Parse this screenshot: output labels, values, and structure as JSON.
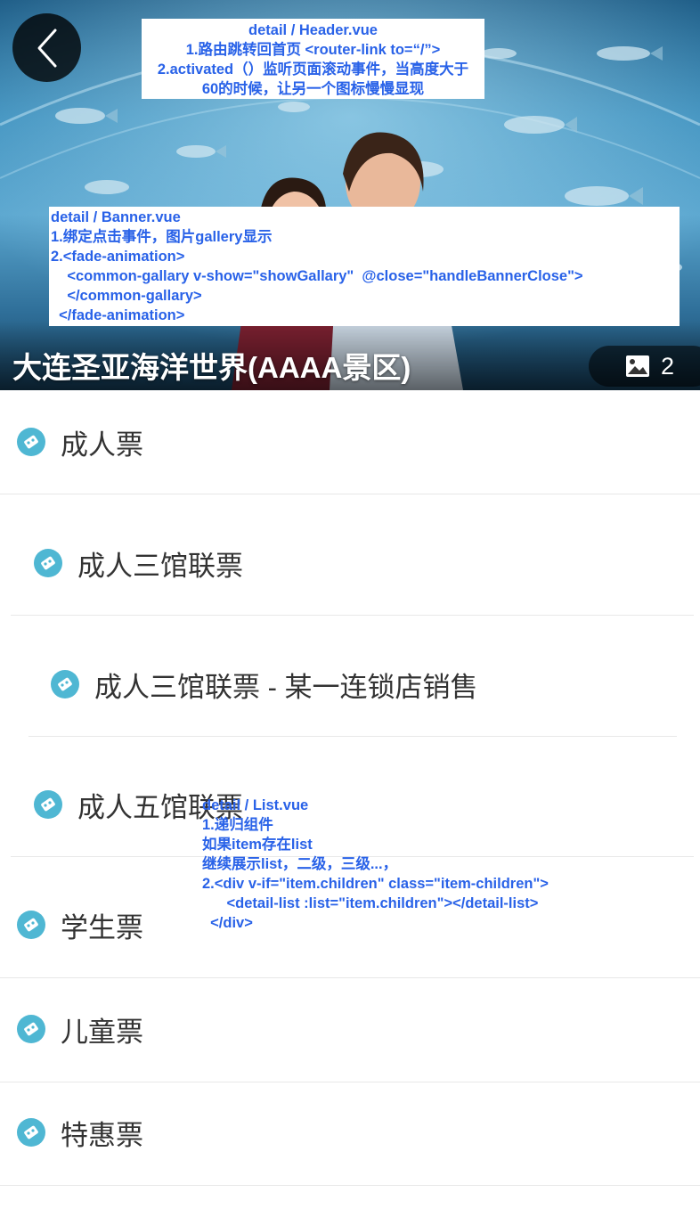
{
  "header": {
    "back_icon": "chevron-left-icon",
    "annotation": {
      "lines": [
        "detail / Header.vue",
        "1.路由跳转回首页 <router-link to=“/”>",
        "2.activated（）监听页面滚动事件，当高度大于",
        "60的时候，让另一个图标慢慢显现"
      ]
    }
  },
  "banner": {
    "title": "大连圣亚海洋世界(AAAA景区)",
    "gallery_icon": "image-icon",
    "gallery_count": "2",
    "annotation": {
      "lines": [
        "detail / Banner.vue",
        "1.绑定点击事件，图片gallery显示",
        "2.<fade-animation>",
        "    <common-gallary v-show=\"showGallary\"  @close=\"handleBannerClose\">",
        "    </common-gallary>",
        "  </fade-animation>"
      ]
    }
  },
  "list": {
    "annotation": {
      "lines": [
        "detail / List.vue",
        "1.递归组件",
        "如果item存在list",
        "继续展示list，二级，三级...，",
        "2.<div v-if=\"item.children\" class=\"item-children\">",
        "      <detail-list :list=\"item.children\"></detail-list>",
        "  </div>"
      ]
    },
    "items": [
      {
        "label": "成人票",
        "icon": "ticket-icon",
        "level": 1
      },
      {
        "label": "成人三馆联票",
        "icon": "ticket-icon",
        "level": 2
      },
      {
        "label": "成人三馆联票 - 某一连锁店销售",
        "icon": "ticket-icon",
        "level": 3
      },
      {
        "label": "成人五馆联票",
        "icon": "ticket-icon",
        "level": 2
      },
      {
        "label": "学生票",
        "icon": "ticket-icon",
        "level": 1
      },
      {
        "label": "儿童票",
        "icon": "ticket-icon",
        "level": 1
      },
      {
        "label": "特惠票",
        "icon": "ticket-icon",
        "level": 1
      }
    ]
  },
  "colors": {
    "accent": "#4fb7d3",
    "annotation_text": "#2962e8",
    "text": "#333333",
    "divider": "#e8e8e8"
  }
}
